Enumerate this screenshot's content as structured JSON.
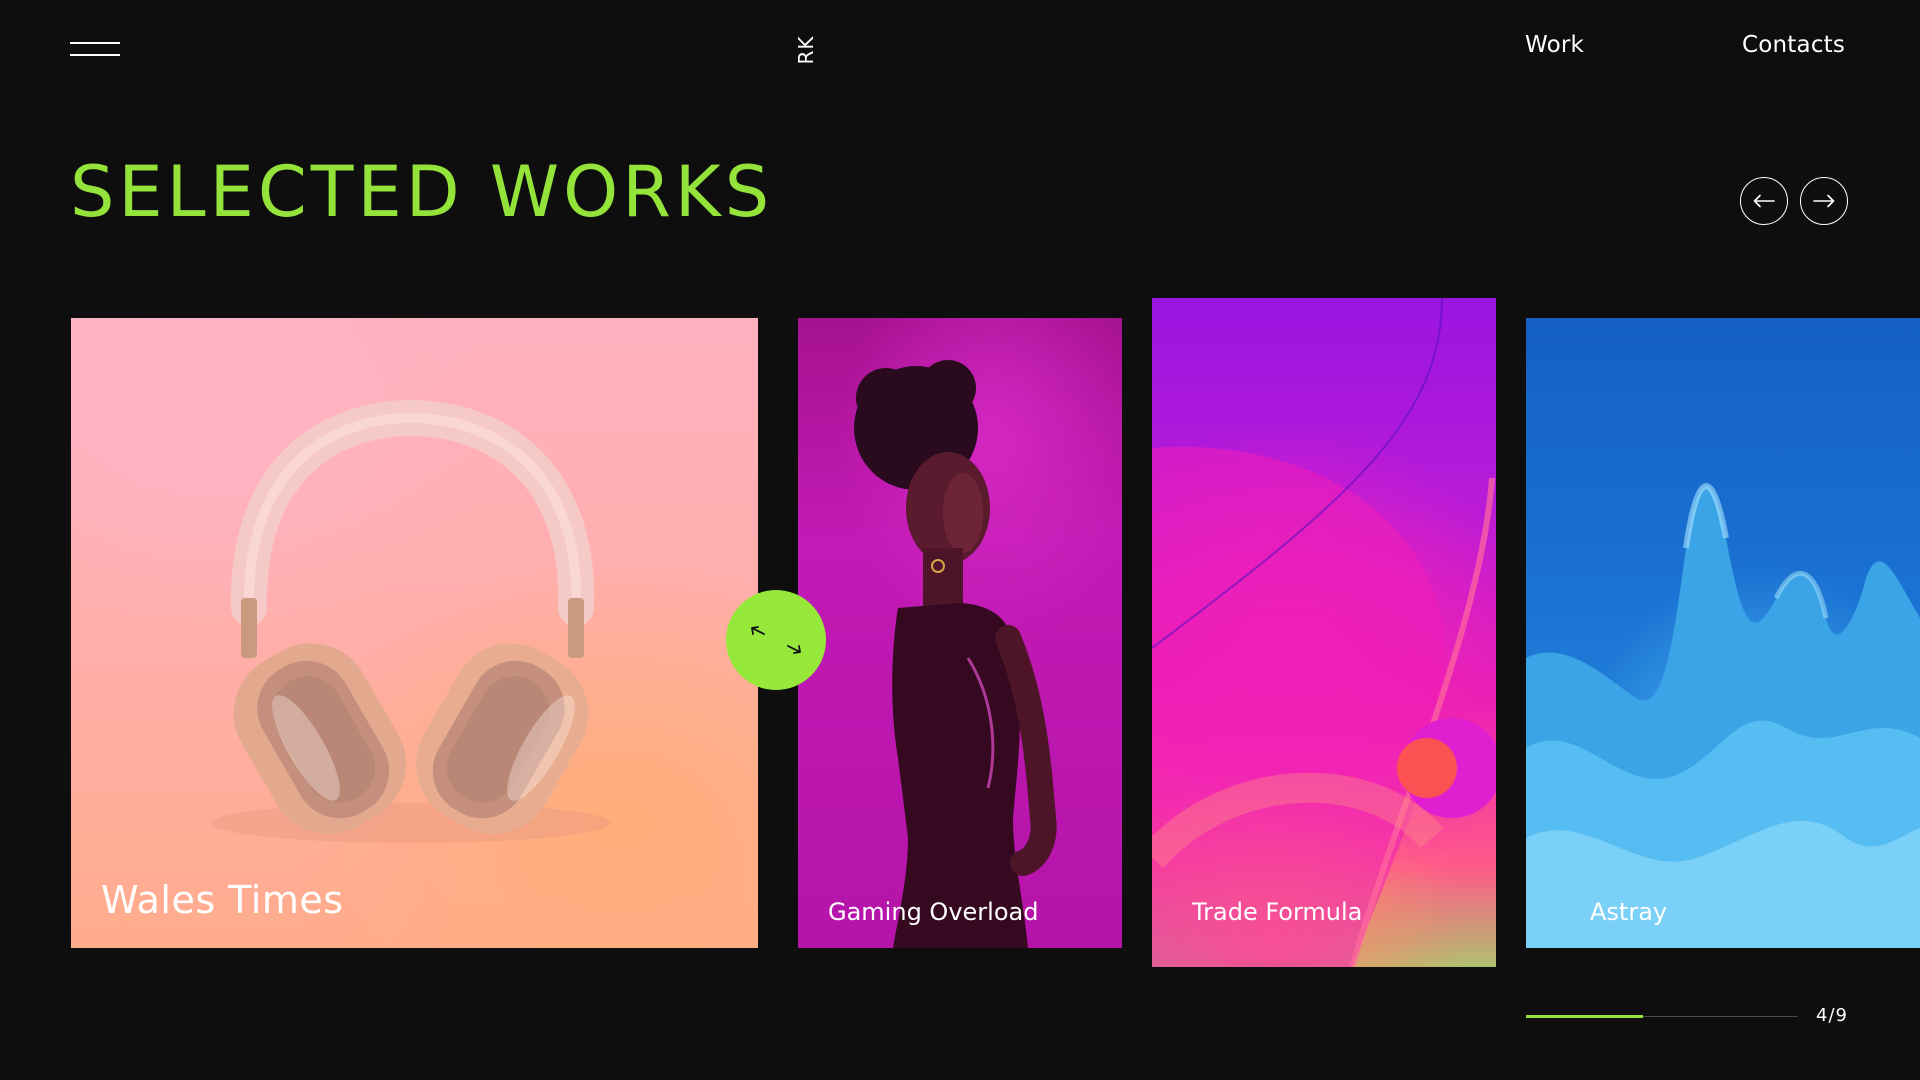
{
  "header": {
    "logo": "RK",
    "nav": [
      {
        "label": "Work"
      },
      {
        "label": "Contacts"
      }
    ]
  },
  "main": {
    "title": "SELECTED WORKS",
    "slides": [
      {
        "title": "Wales Times"
      },
      {
        "title": "Gaming Overload"
      },
      {
        "title": "Trade Formula"
      },
      {
        "title": "Astray"
      }
    ]
  },
  "pagination": {
    "counter": "4/9",
    "current": 4,
    "total": 9,
    "progress_fraction": 0.43
  },
  "icons": {
    "menu": "hamburger-icon",
    "prev": "arrow-left-icon",
    "next": "arrow-right-icon",
    "drag": "drag-cursor-icon"
  },
  "colors": {
    "background": "#0e0e0e",
    "accent": "#93e33a",
    "text": "#ffffff"
  }
}
